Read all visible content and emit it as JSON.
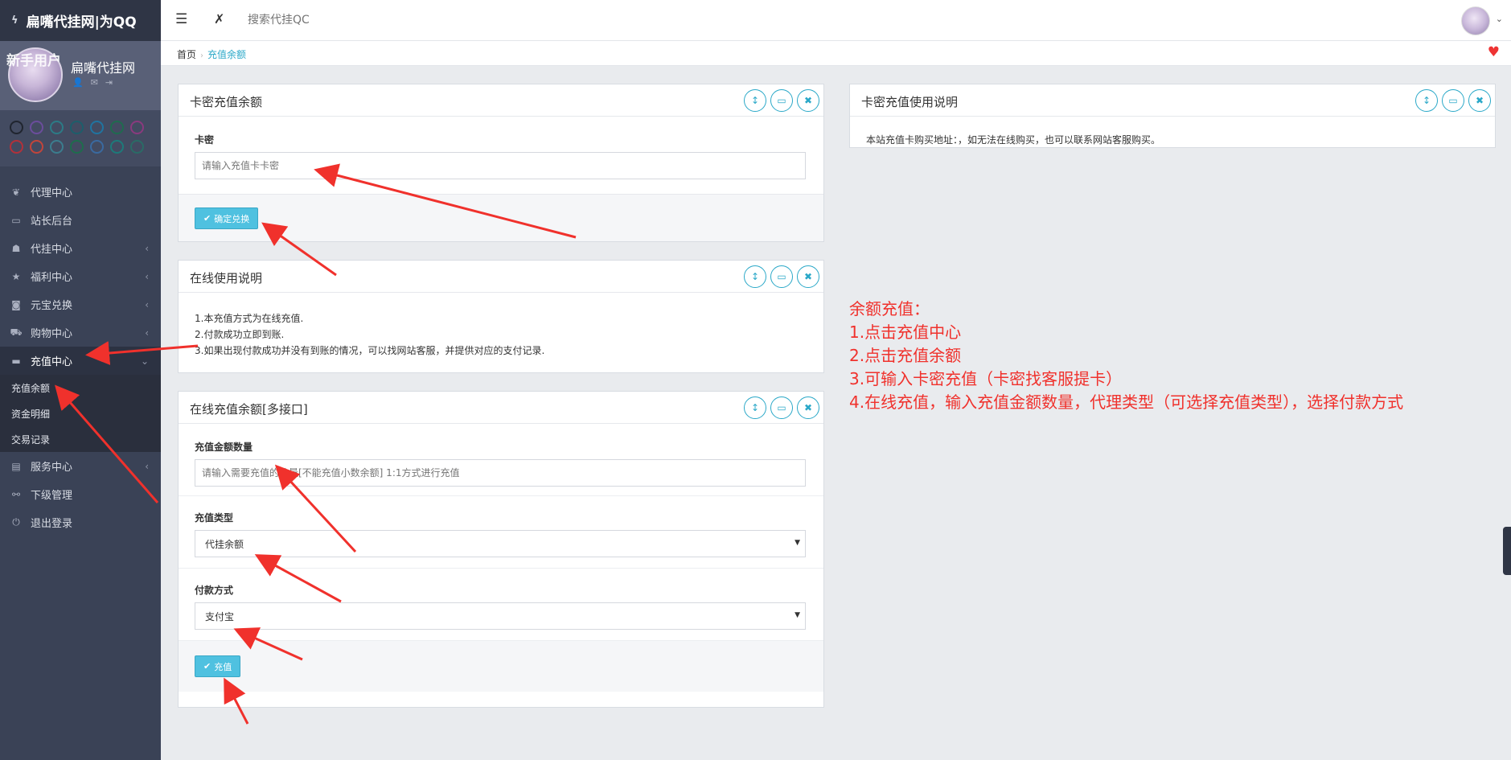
{
  "brand": {
    "title": "扁嘴代挂网|为QQ"
  },
  "user": {
    "name": "扁嘴代挂网",
    "overlay": "新手用户"
  },
  "theme_colors": {
    "row1": [
      "#20252f",
      "#6b4d9c",
      "#2c7b86",
      "#1d5e6b",
      "#2074a0",
      "#1f6b4f",
      "#8a3a7e"
    ],
    "row2": [
      "#b2313a",
      "#c2453b",
      "#3b7d8e",
      "#1e6d4d",
      "#3a6aa0",
      "#1d7a7a",
      "#2a6b66"
    ]
  },
  "nav": [
    {
      "label": "代理中心",
      "icon": "leaf-icon",
      "glyph": "❦",
      "chevron": ""
    },
    {
      "label": "站长后台",
      "icon": "laptop-icon",
      "glyph": "▭",
      "chevron": ""
    },
    {
      "label": "代挂中心",
      "icon": "qq-icon",
      "glyph": "☗",
      "chevron": "‹"
    },
    {
      "label": "福利中心",
      "icon": "star-icon",
      "glyph": "★",
      "chevron": "‹"
    },
    {
      "label": "元宝兑换",
      "icon": "money-icon",
      "glyph": "◙",
      "chevron": "‹"
    },
    {
      "label": "购物中心",
      "icon": "cart-icon",
      "glyph": "⛟",
      "chevron": "‹"
    },
    {
      "label": "充值中心",
      "icon": "card-icon",
      "glyph": "▬",
      "chevron": "⌄"
    }
  ],
  "subnav": [
    "充值余额",
    "资金明细",
    "交易记录"
  ],
  "nav_after": [
    {
      "label": "服务中心",
      "icon": "document-icon",
      "glyph": "▤",
      "chevron": "‹"
    },
    {
      "label": "下级管理",
      "icon": "sitemap-icon",
      "glyph": "⚯",
      "chevron": ""
    },
    {
      "label": "退出登录",
      "icon": "power-icon",
      "glyph": "⏻",
      "chevron": ""
    }
  ],
  "topbar": {
    "search_placeholder": "搜索代挂QC"
  },
  "breadcrumb": {
    "home": "首页",
    "current": "充值余额"
  },
  "card_panel": {
    "title": "卡密充值余额",
    "label": "卡密",
    "placeholder": "请输入充值卡卡密",
    "button": "确定兑换"
  },
  "online_info_panel": {
    "title": "在线使用说明",
    "lines": [
      "1.本充值方式为在线充值.",
      "2.付款成功立即到账.",
      "3.如果出现付款成功并没有到账的情况，可以找网站客服，并提供对应的支付记录."
    ]
  },
  "online_panel": {
    "title": "在线充值余额[多接口]",
    "amount_label": "充值金额数量",
    "amount_placeholder": "请输入需要充值的数量[不能充值小数余额] 1:1方式进行充值",
    "type_label": "充值类型",
    "type_value": "代挂余额",
    "pay_label": "付款方式",
    "pay_value": "支付宝",
    "button": "充值"
  },
  "card_info_panel": {
    "title": "卡密充值使用说明",
    "text": "本站充值卡购买地址：，如无法在线购买，也可以联系网站客服购买。"
  },
  "annotation": {
    "lines": [
      "余额充值：",
      "1.点击充值中心",
      "2.点击充值余额",
      "3.可输入卡密充值（卡密找客服提卡）",
      "4.在线充值，输入充值金额数量，代理类型（可选择充值类型），选择付款方式"
    ],
    "color": "#f0312c"
  }
}
